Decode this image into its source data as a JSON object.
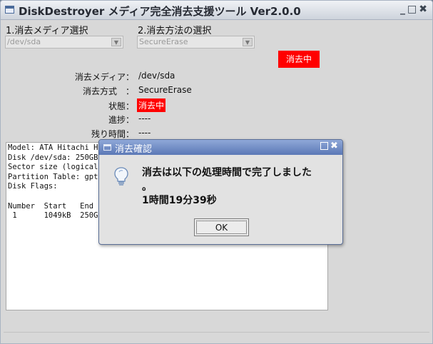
{
  "window": {
    "title": "DiskDestroyer メディア完全消去支援ツール Ver2.0.0",
    "controls": [
      "_",
      "□",
      "✖"
    ]
  },
  "section1": {
    "label": "1.消去メディア選択",
    "combo_value": "/dev/sda"
  },
  "section2": {
    "label": "2.消去方法の選択",
    "combo_value": "SecureErase"
  },
  "erase_button": "消去中",
  "info": {
    "media_key": "消去メディア：",
    "media_val": "/dev/sda",
    "method_key": "消去方式　：",
    "method_val": "SecureErase",
    "state_key": "状態：",
    "state_val": "消去中",
    "progress_key": "進捗：",
    "progress_val": "----",
    "remaining_key": "残り時間：",
    "remaining_val": "----"
  },
  "output_text": "Model: ATA Hitachi H\nDisk /dev/sda: 250GB\nSector size (logical\nPartition Table: gpt\nDisk Flags:\n\nNumber  Start   End\n 1      1049kB  250G",
  "dialog": {
    "title": "消去確認",
    "message": "消去は以下の処理時間で完了しました",
    "period": "。",
    "duration": "1時間19分39秒",
    "ok": "OK"
  },
  "colors": {
    "accent_red": "#ff0000",
    "dialog_title": "#5b78b6"
  }
}
